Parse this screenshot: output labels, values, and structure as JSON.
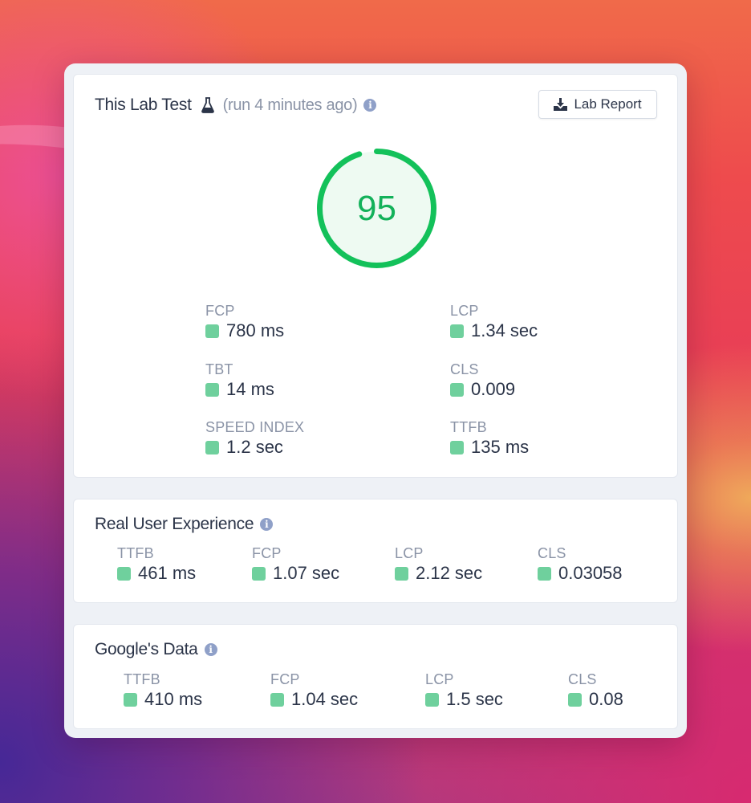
{
  "lab_test": {
    "title": "This Lab Test",
    "subtitle": "(run 4 minutes ago)",
    "report_button": "Lab Report",
    "score": "95",
    "score_fraction": 0.95,
    "metrics": [
      {
        "label": "FCP",
        "value": "780 ms"
      },
      {
        "label": "LCP",
        "value": "1.34 sec"
      },
      {
        "label": "TBT",
        "value": "14 ms"
      },
      {
        "label": "CLS",
        "value": "0.009"
      },
      {
        "label": "SPEED INDEX",
        "value": "1.2 sec"
      },
      {
        "label": "TTFB",
        "value": "135 ms"
      }
    ]
  },
  "real_user": {
    "title": "Real User Experience",
    "metrics": [
      {
        "label": "TTFB",
        "value": "461 ms"
      },
      {
        "label": "FCP",
        "value": "1.07 sec"
      },
      {
        "label": "LCP",
        "value": "2.12 sec"
      },
      {
        "label": "CLS",
        "value": "0.03058"
      }
    ]
  },
  "google_data": {
    "title": "Google's Data",
    "metrics": [
      {
        "label": "TTFB",
        "value": "410 ms"
      },
      {
        "label": "FCP",
        "value": "1.04 sec"
      },
      {
        "label": "LCP",
        "value": "1.5 sec"
      },
      {
        "label": "CLS",
        "value": "0.08"
      }
    ]
  },
  "colors": {
    "good": "#6fd09d",
    "gauge": "#13c15a",
    "text": "#2b3448",
    "muted": "#8a93a6"
  },
  "icons": {
    "flask": "flask-icon",
    "info": "info-icon",
    "download": "download-icon"
  }
}
